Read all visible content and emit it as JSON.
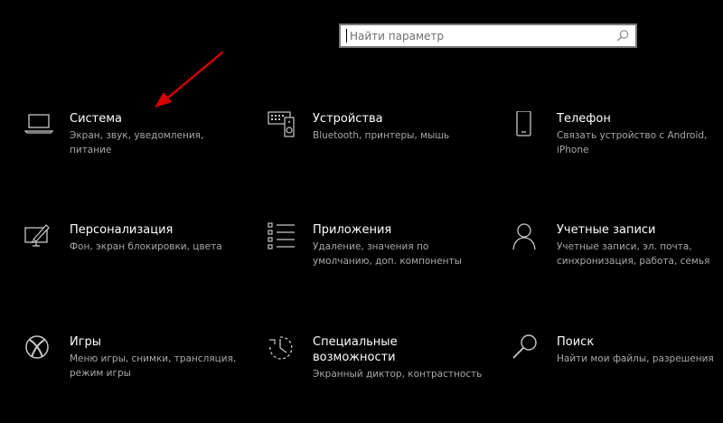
{
  "search": {
    "placeholder": "Найти параметр",
    "icon": "search-icon"
  },
  "tiles": [
    {
      "title": "Система",
      "desc": "Экран, звук, уведомления, питание",
      "icon": "laptop-icon"
    },
    {
      "title": "Устройства",
      "desc": "Bluetooth, принтеры, мышь",
      "icon": "devices-icon"
    },
    {
      "title": "Телефон",
      "desc": "Связать устройство с Android, iPhone",
      "icon": "phone-icon"
    },
    {
      "title": "Персонализация",
      "desc": "Фон, экран блокировки, цвета",
      "icon": "personalization-icon"
    },
    {
      "title": "Приложения",
      "desc": "Удаление, значения по умолчанию, доп. компоненты",
      "icon": "apps-list-icon"
    },
    {
      "title": "Учетные записи",
      "desc": "Учетные записи, эл. почта, синхронизация, работа, семья",
      "icon": "person-icon"
    },
    {
      "title": "Игры",
      "desc": "Меню игры, снимки, трансляция, режим игры",
      "icon": "xbox-icon"
    },
    {
      "title": "Специальные возможности",
      "desc": "Экранный диктор, контрастность",
      "icon": "ease-of-access-icon"
    },
    {
      "title": "Поиск",
      "desc": "Найти мои файлы, разрешения",
      "icon": "search-magnifier-icon"
    }
  ],
  "colors": {
    "background": "#000000",
    "title": "#ffffff",
    "description": "#a8a8a8",
    "icon": "#c8c8c8",
    "annotation_arrow": "#d80000"
  }
}
